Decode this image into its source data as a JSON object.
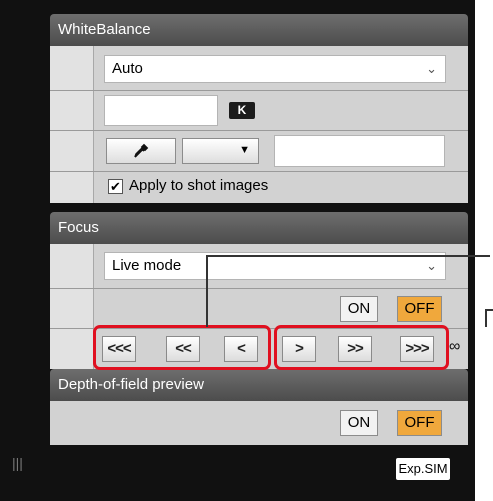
{
  "white_balance": {
    "header": "WhiteBalance",
    "preset_value": "Auto",
    "kelvin_value": "",
    "kelvin_badge": "K",
    "dropdown_value": "",
    "apply_label": "Apply to shot images",
    "apply_checked_glyph": "✔"
  },
  "focus": {
    "header": "Focus",
    "mode_value": "Live mode",
    "on_label": "ON",
    "off_label": "OFF",
    "near_buttons": [
      "<<<",
      "<<",
      "<"
    ],
    "far_buttons": [
      ">",
      ">>",
      ">>>"
    ],
    "infinity_symbol": "∞"
  },
  "depth_of_field": {
    "header": "Depth-of-field preview",
    "on_label": "ON",
    "off_label": "OFF"
  },
  "footer": {
    "exp_sim_label": "Exp.SIM"
  },
  "icons": {
    "eyedropper": "eyedropper-icon",
    "chevron": "chevron-down-icon",
    "grip": "resize-grip-icon"
  },
  "colors": {
    "panel_bg": "#111111",
    "header_bg": "#5c5c5c",
    "row_bg": "#d2d2d2",
    "active_toggle": "#f0a83c",
    "highlight_box": "#e01020"
  }
}
